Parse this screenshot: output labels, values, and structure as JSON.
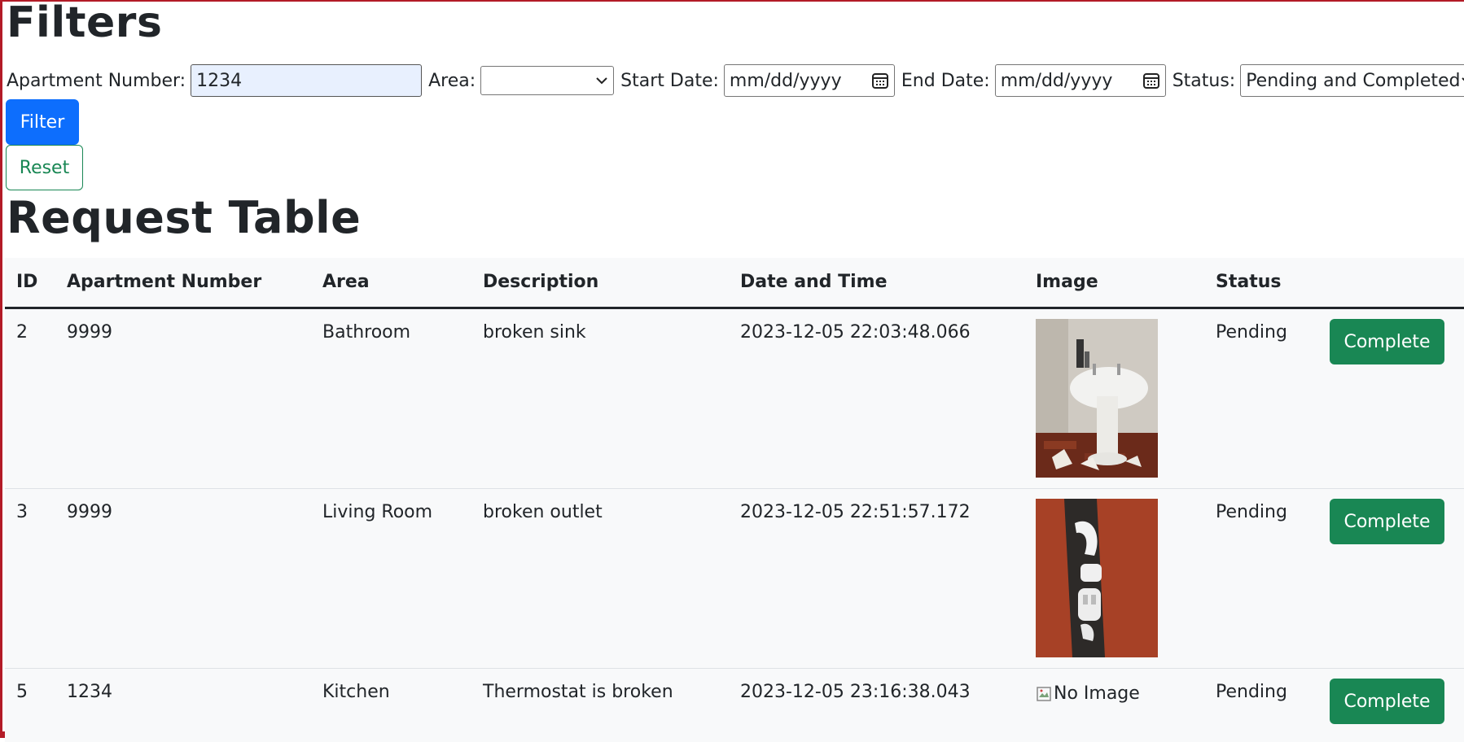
{
  "filters": {
    "title": "Filters",
    "apartment_label": "Apartment Number:",
    "apartment_value": "1234",
    "area_label": "Area:",
    "area_value": "",
    "start_label": "Start Date:",
    "start_placeholder": "mm/dd/yyyy",
    "end_label": "End Date:",
    "end_placeholder": "mm/dd/yyyy",
    "status_label": "Status:",
    "status_value": "Pending and Completed",
    "filter_button": "Filter",
    "reset_button": "Reset",
    "colors": {
      "primary": "#0d6efd",
      "success": "#198754"
    }
  },
  "table": {
    "title": "Request Table",
    "headers": [
      "ID",
      "Apartment Number",
      "Area",
      "Description",
      "Date and Time",
      "Image",
      "Status"
    ],
    "rows": [
      {
        "id": "2",
        "apartment": "9999",
        "area": "Bathroom",
        "description": "broken sink",
        "datetime": "2023-12-05 22:03:48.066",
        "image": "broken-sink-photo",
        "status": "Pending",
        "action": "Complete"
      },
      {
        "id": "3",
        "apartment": "9999",
        "area": "Living Room",
        "description": "broken outlet",
        "datetime": "2023-12-05 22:51:57.172",
        "image": "broken-outlet-photo",
        "status": "Pending",
        "action": "Complete"
      },
      {
        "id": "5",
        "apartment": "1234",
        "area": "Kitchen",
        "description": "Thermostat is broken",
        "datetime": "2023-12-05 23:16:38.043",
        "image_alt": "No Image",
        "status": "Pending",
        "action": "Complete"
      }
    ]
  }
}
